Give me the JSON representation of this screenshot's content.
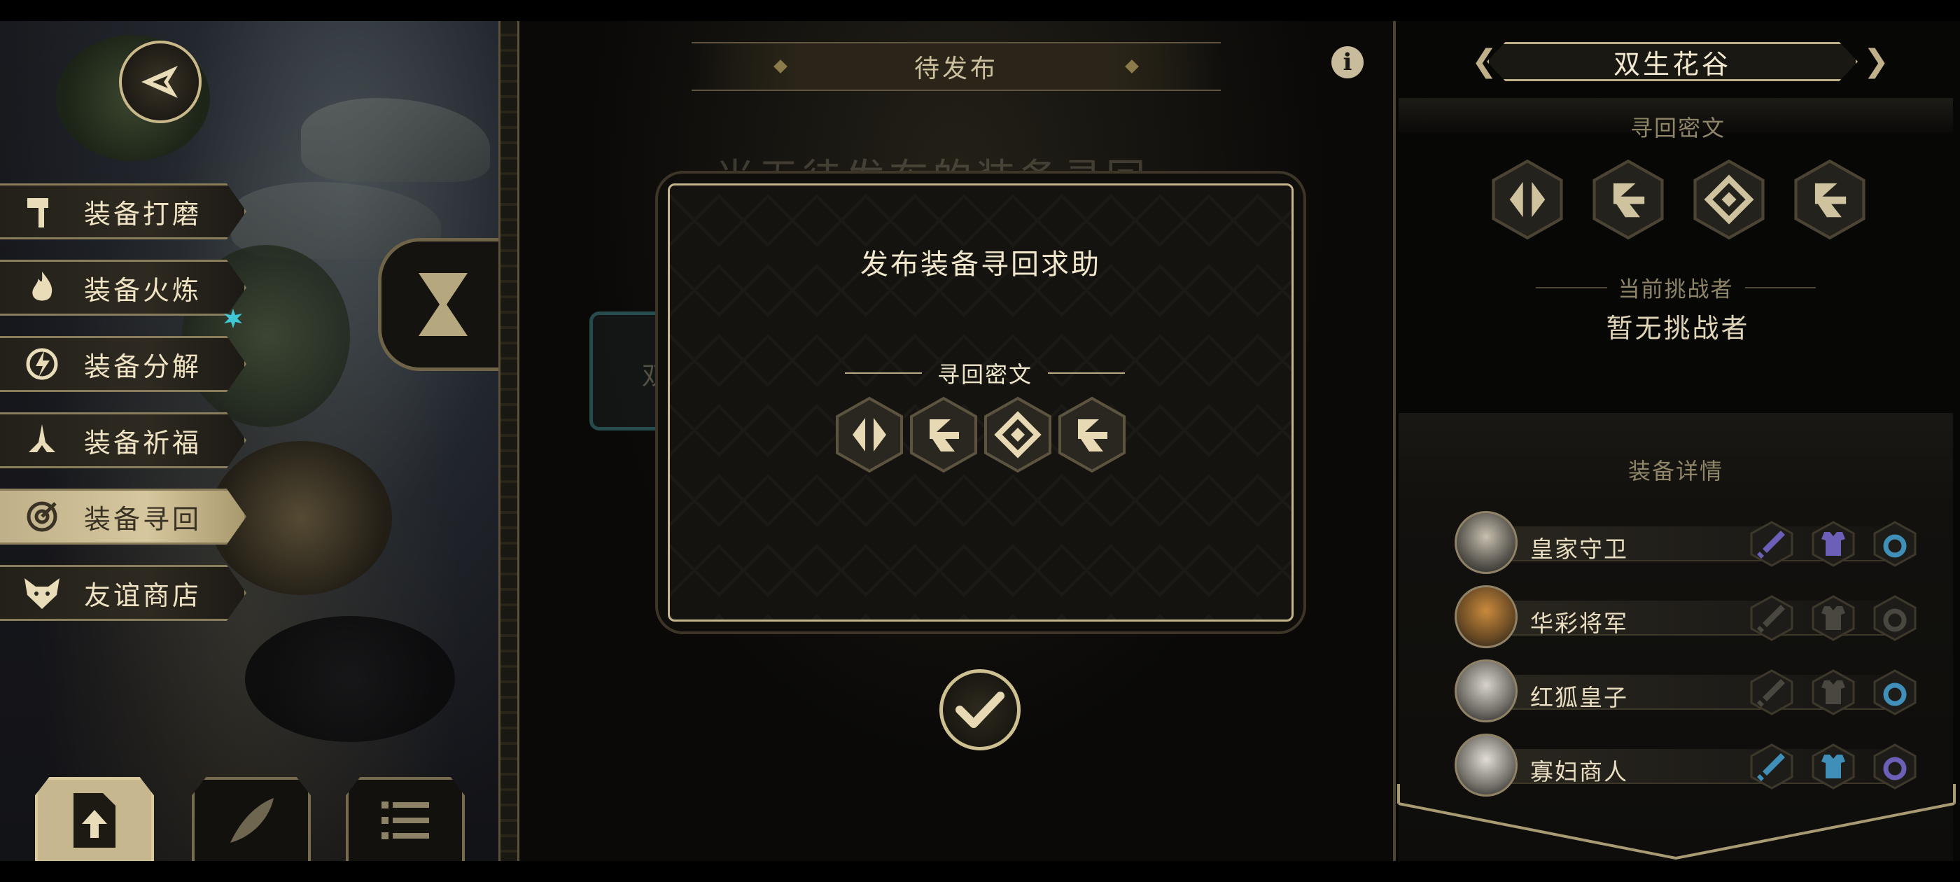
{
  "left_menu": {
    "items": [
      {
        "label": "装备打磨",
        "icon": "hammer-icon"
      },
      {
        "label": "装备火炼",
        "icon": "flame-icon"
      },
      {
        "label": "装备分解",
        "icon": "decompose-icon"
      },
      {
        "label": "装备祈福",
        "icon": "pray-icon"
      },
      {
        "label": "装备寻回",
        "icon": "target-icon"
      },
      {
        "label": "友谊商店",
        "icon": "fox-icon"
      }
    ],
    "active_index": 4
  },
  "bottom_tabs": [
    {
      "icon": "upload-file-icon"
    },
    {
      "icon": "feather-icon"
    },
    {
      "icon": "list-icon"
    }
  ],
  "center": {
    "banner_title": "待发布",
    "faded_text": "当无待发布的装备寻回",
    "faded_tab_char": "双",
    "dialog": {
      "title": "发布装备寻回求助",
      "cipher_label": "寻回密文",
      "runes": [
        "rune-split",
        "rune-swirl",
        "rune-diamond",
        "rune-swirl"
      ]
    }
  },
  "right_panel": {
    "location_name": "双生花谷",
    "cipher_title": "寻回密文",
    "runes": [
      "rune-split",
      "rune-swirl",
      "rune-diamond",
      "rune-swirl"
    ],
    "challenger_label": "当前挑战者",
    "challenger_value": "暂无挑战者",
    "equip_title": "装备详情",
    "equipment": [
      {
        "name": "皇家守卫",
        "slots": {
          "weapon": "#6c5fb8",
          "armor": "#6c5fb8",
          "ring": "#3f8fb8"
        }
      },
      {
        "name": "华彩将军",
        "slots": {
          "weapon": "#4a4740",
          "armor": "#4a4740",
          "ring": "#4a4740"
        }
      },
      {
        "name": "红狐皇子",
        "slots": {
          "weapon": "#4a4740",
          "armor": "#4a4740",
          "ring": "#3f8fb8"
        }
      },
      {
        "name": "寡妇商人",
        "slots": {
          "weapon": "#3f8fb8",
          "armor": "#3f8fb8",
          "ring": "#6c5fb8"
        }
      }
    ]
  },
  "colors": {
    "gold": "#c8b88a",
    "notify": "#3fc7d6"
  }
}
